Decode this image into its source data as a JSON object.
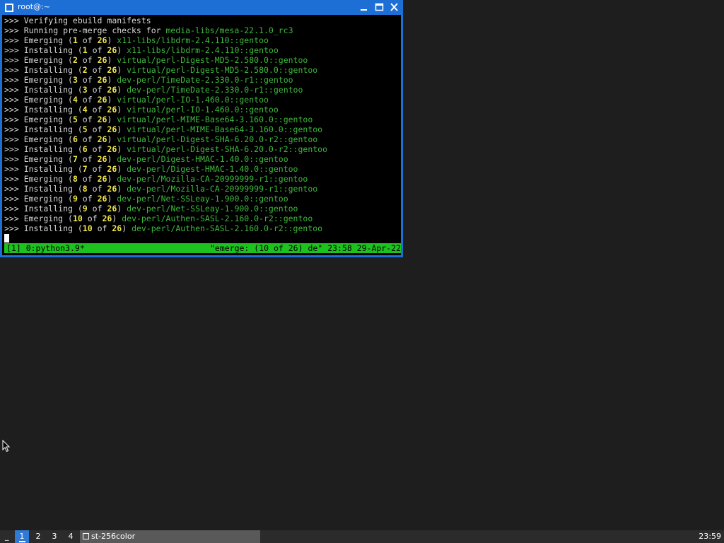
{
  "window": {
    "title": "root@:~"
  },
  "terminal": {
    "lines": [
      [
        {
          "t": ">>> Verifying ebuild manifests",
          "c": "n"
        }
      ],
      [
        {
          "t": ">>> Running pre-merge checks for ",
          "c": "n"
        },
        {
          "t": "media-libs/mesa-22.1.0_rc3",
          "c": "p"
        }
      ],
      [
        {
          "t": ">>> Emerging (",
          "c": "n"
        },
        {
          "t": "1",
          "c": "y"
        },
        {
          "t": " of ",
          "c": "n"
        },
        {
          "t": "26",
          "c": "y"
        },
        {
          "t": ") ",
          "c": "n"
        },
        {
          "t": "x11-libs/libdrm-2.4.110::gentoo",
          "c": "p"
        }
      ],
      [
        {
          "t": ">>> Installing (",
          "c": "n"
        },
        {
          "t": "1",
          "c": "y"
        },
        {
          "t": " of ",
          "c": "n"
        },
        {
          "t": "26",
          "c": "y"
        },
        {
          "t": ") ",
          "c": "n"
        },
        {
          "t": "x11-libs/libdrm-2.4.110::gentoo",
          "c": "p"
        }
      ],
      [
        {
          "t": ">>> Emerging (",
          "c": "n"
        },
        {
          "t": "2",
          "c": "y"
        },
        {
          "t": " of ",
          "c": "n"
        },
        {
          "t": "26",
          "c": "y"
        },
        {
          "t": ") ",
          "c": "n"
        },
        {
          "t": "virtual/perl-Digest-MD5-2.580.0::gentoo",
          "c": "p"
        }
      ],
      [
        {
          "t": ">>> Installing (",
          "c": "n"
        },
        {
          "t": "2",
          "c": "y"
        },
        {
          "t": " of ",
          "c": "n"
        },
        {
          "t": "26",
          "c": "y"
        },
        {
          "t": ") ",
          "c": "n"
        },
        {
          "t": "virtual/perl-Digest-MD5-2.580.0::gentoo",
          "c": "p"
        }
      ],
      [
        {
          "t": ">>> Emerging (",
          "c": "n"
        },
        {
          "t": "3",
          "c": "y"
        },
        {
          "t": " of ",
          "c": "n"
        },
        {
          "t": "26",
          "c": "y"
        },
        {
          "t": ") ",
          "c": "n"
        },
        {
          "t": "dev-perl/TimeDate-2.330.0-r1::gentoo",
          "c": "p"
        }
      ],
      [
        {
          "t": ">>> Installing (",
          "c": "n"
        },
        {
          "t": "3",
          "c": "y"
        },
        {
          "t": " of ",
          "c": "n"
        },
        {
          "t": "26",
          "c": "y"
        },
        {
          "t": ") ",
          "c": "n"
        },
        {
          "t": "dev-perl/TimeDate-2.330.0-r1::gentoo",
          "c": "p"
        }
      ],
      [
        {
          "t": ">>> Emerging (",
          "c": "n"
        },
        {
          "t": "4",
          "c": "y"
        },
        {
          "t": " of ",
          "c": "n"
        },
        {
          "t": "26",
          "c": "y"
        },
        {
          "t": ") ",
          "c": "n"
        },
        {
          "t": "virtual/perl-IO-1.460.0::gentoo",
          "c": "p"
        }
      ],
      [
        {
          "t": ">>> Installing (",
          "c": "n"
        },
        {
          "t": "4",
          "c": "y"
        },
        {
          "t": " of ",
          "c": "n"
        },
        {
          "t": "26",
          "c": "y"
        },
        {
          "t": ") ",
          "c": "n"
        },
        {
          "t": "virtual/perl-IO-1.460.0::gentoo",
          "c": "p"
        }
      ],
      [
        {
          "t": ">>> Emerging (",
          "c": "n"
        },
        {
          "t": "5",
          "c": "y"
        },
        {
          "t": " of ",
          "c": "n"
        },
        {
          "t": "26",
          "c": "y"
        },
        {
          "t": ") ",
          "c": "n"
        },
        {
          "t": "virtual/perl-MIME-Base64-3.160.0::gentoo",
          "c": "p"
        }
      ],
      [
        {
          "t": ">>> Installing (",
          "c": "n"
        },
        {
          "t": "5",
          "c": "y"
        },
        {
          "t": " of ",
          "c": "n"
        },
        {
          "t": "26",
          "c": "y"
        },
        {
          "t": ") ",
          "c": "n"
        },
        {
          "t": "virtual/perl-MIME-Base64-3.160.0::gentoo",
          "c": "p"
        }
      ],
      [
        {
          "t": ">>> Emerging (",
          "c": "n"
        },
        {
          "t": "6",
          "c": "y"
        },
        {
          "t": " of ",
          "c": "n"
        },
        {
          "t": "26",
          "c": "y"
        },
        {
          "t": ") ",
          "c": "n"
        },
        {
          "t": "virtual/perl-Digest-SHA-6.20.0-r2::gentoo",
          "c": "p"
        }
      ],
      [
        {
          "t": ">>> Installing (",
          "c": "n"
        },
        {
          "t": "6",
          "c": "y"
        },
        {
          "t": " of ",
          "c": "n"
        },
        {
          "t": "26",
          "c": "y"
        },
        {
          "t": ") ",
          "c": "n"
        },
        {
          "t": "virtual/perl-Digest-SHA-6.20.0-r2::gentoo",
          "c": "p"
        }
      ],
      [
        {
          "t": ">>> Emerging (",
          "c": "n"
        },
        {
          "t": "7",
          "c": "y"
        },
        {
          "t": " of ",
          "c": "n"
        },
        {
          "t": "26",
          "c": "y"
        },
        {
          "t": ") ",
          "c": "n"
        },
        {
          "t": "dev-perl/Digest-HMAC-1.40.0::gentoo",
          "c": "p"
        }
      ],
      [
        {
          "t": ">>> Installing (",
          "c": "n"
        },
        {
          "t": "7",
          "c": "y"
        },
        {
          "t": " of ",
          "c": "n"
        },
        {
          "t": "26",
          "c": "y"
        },
        {
          "t": ") ",
          "c": "n"
        },
        {
          "t": "dev-perl/Digest-HMAC-1.40.0::gentoo",
          "c": "p"
        }
      ],
      [
        {
          "t": ">>> Emerging (",
          "c": "n"
        },
        {
          "t": "8",
          "c": "y"
        },
        {
          "t": " of ",
          "c": "n"
        },
        {
          "t": "26",
          "c": "y"
        },
        {
          "t": ") ",
          "c": "n"
        },
        {
          "t": "dev-perl/Mozilla-CA-20999999-r1::gentoo",
          "c": "p"
        }
      ],
      [
        {
          "t": ">>> Installing (",
          "c": "n"
        },
        {
          "t": "8",
          "c": "y"
        },
        {
          "t": " of ",
          "c": "n"
        },
        {
          "t": "26",
          "c": "y"
        },
        {
          "t": ") ",
          "c": "n"
        },
        {
          "t": "dev-perl/Mozilla-CA-20999999-r1::gentoo",
          "c": "p"
        }
      ],
      [
        {
          "t": ">>> Emerging (",
          "c": "n"
        },
        {
          "t": "9",
          "c": "y"
        },
        {
          "t": " of ",
          "c": "n"
        },
        {
          "t": "26",
          "c": "y"
        },
        {
          "t": ") ",
          "c": "n"
        },
        {
          "t": "dev-perl/Net-SSLeay-1.900.0::gentoo",
          "c": "p"
        }
      ],
      [
        {
          "t": ">>> Installing (",
          "c": "n"
        },
        {
          "t": "9",
          "c": "y"
        },
        {
          "t": " of ",
          "c": "n"
        },
        {
          "t": "26",
          "c": "y"
        },
        {
          "t": ") ",
          "c": "n"
        },
        {
          "t": "dev-perl/Net-SSLeay-1.900.0::gentoo",
          "c": "p"
        }
      ],
      [
        {
          "t": ">>> Emerging (",
          "c": "n"
        },
        {
          "t": "10",
          "c": "y"
        },
        {
          "t": " of ",
          "c": "n"
        },
        {
          "t": "26",
          "c": "y"
        },
        {
          "t": ") ",
          "c": "n"
        },
        {
          "t": "dev-perl/Authen-SASL-2.160.0-r2::gentoo",
          "c": "p"
        }
      ],
      [
        {
          "t": ">>> Installing (",
          "c": "n"
        },
        {
          "t": "10",
          "c": "y"
        },
        {
          "t": " of ",
          "c": "n"
        },
        {
          "t": "26",
          "c": "y"
        },
        {
          "t": ") ",
          "c": "n"
        },
        {
          "t": "dev-perl/Authen-SASL-2.160.0-r2::gentoo",
          "c": "p"
        }
      ]
    ]
  },
  "status": {
    "left": "[1] 0:python3.9*",
    "right": "\"emerge: (10 of 26) de\" 23:58 29-Apr-22"
  },
  "taskbar": {
    "menu_glyph": "_",
    "workspaces": [
      "1",
      "2",
      "3",
      "4"
    ],
    "active_workspace": "1",
    "task_label": "st-256color",
    "clock": "23:59"
  },
  "colors": {
    "titlebar": "#1d6fd6",
    "package": "#3db83d",
    "number": "#f0e84a",
    "statusbar": "#1ec21e",
    "taskbar": "#2b2b2b"
  }
}
